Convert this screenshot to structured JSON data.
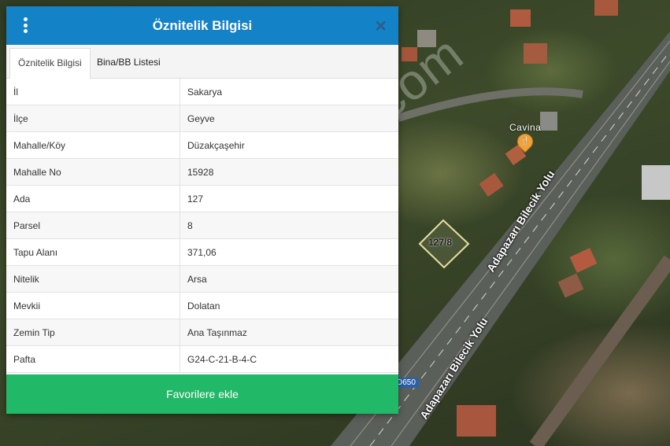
{
  "panel": {
    "title": "Öznitelik Bilgisi",
    "tabs": [
      {
        "label": "Öznitelik Bilgisi",
        "active": true
      },
      {
        "label": "Bina/BB Listesi",
        "active": false
      }
    ],
    "attributes": [
      {
        "key": "İl",
        "value": "Sakarya"
      },
      {
        "key": "İlçe",
        "value": "Geyve"
      },
      {
        "key": "Mahalle/Köy",
        "value": "Düzakçaşehir"
      },
      {
        "key": "Mahalle No",
        "value": "15928"
      },
      {
        "key": "Ada",
        "value": "127"
      },
      {
        "key": "Parsel",
        "value": "8"
      },
      {
        "key": "Tapu Alanı",
        "value": "371,06"
      },
      {
        "key": "Nitelik",
        "value": "Arsa"
      },
      {
        "key": "Mevkii",
        "value": "Dolatan"
      },
      {
        "key": "Zemin Tip",
        "value": "Ana Taşınmaz"
      },
      {
        "key": "Pafta",
        "value": "G24-C-21-B-4-C"
      }
    ],
    "favorite_button": "Favorilere ekle",
    "header_color": "#1482c7",
    "button_color": "#21b868"
  },
  "map": {
    "parcel_label": "127/8",
    "poi_label": "Cavina",
    "road_labels": [
      "Adapazarı Bilecik Yolu",
      "Adapazarı Bilecik Yolu"
    ],
    "road_number": "D650",
    "watermark": "emlakjet.com"
  },
  "icons": {
    "menu": "vertical-dots-icon",
    "close": "close-icon",
    "poi": "restaurant-pin-icon"
  }
}
